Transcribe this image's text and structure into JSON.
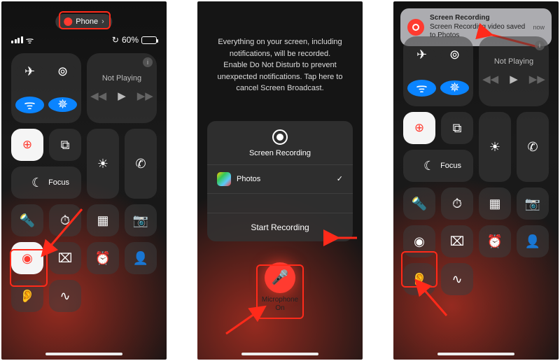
{
  "status": {
    "battery_pct": "60%"
  },
  "pill": {
    "label": "Phone",
    "chev": "›"
  },
  "media": {
    "title": "Not Playing"
  },
  "focus": {
    "label": "Focus"
  },
  "center": {
    "message": "Everything on your screen, including notifications, will be recorded. Enable Do Not Disturb to prevent unexpected notifications. Tap here to cancel Screen Broadcast.",
    "sheet_title": "Screen Recording",
    "dest_app": "Photos",
    "check": "✓",
    "start": "Start Recording",
    "mic_label": "Microphone",
    "mic_state": "On"
  },
  "banner": {
    "title": "Screen Recording",
    "subtitle": "Screen Recording video saved to Photos",
    "time": "now"
  },
  "icons": {
    "airplane": "✈",
    "antenna": "⊚",
    "wifi": "ᯤ",
    "bluetooth": "✵",
    "back": "◀◀",
    "play": "▶",
    "fwd": "▶▶",
    "mirror": "⧉",
    "moon": "☾",
    "bright": "☀",
    "phone": "✆",
    "flash": "🔦",
    "timer": "⏱",
    "calc": "▦",
    "camera": "📷",
    "record": "◉",
    "lowpow": "⌧",
    "alarm": "⏰",
    "person": "👤",
    "ear": "👂",
    "shazam": "∿",
    "recharge": "↻",
    "mic": "🎤",
    "info": "i",
    "lock": "⊕"
  }
}
